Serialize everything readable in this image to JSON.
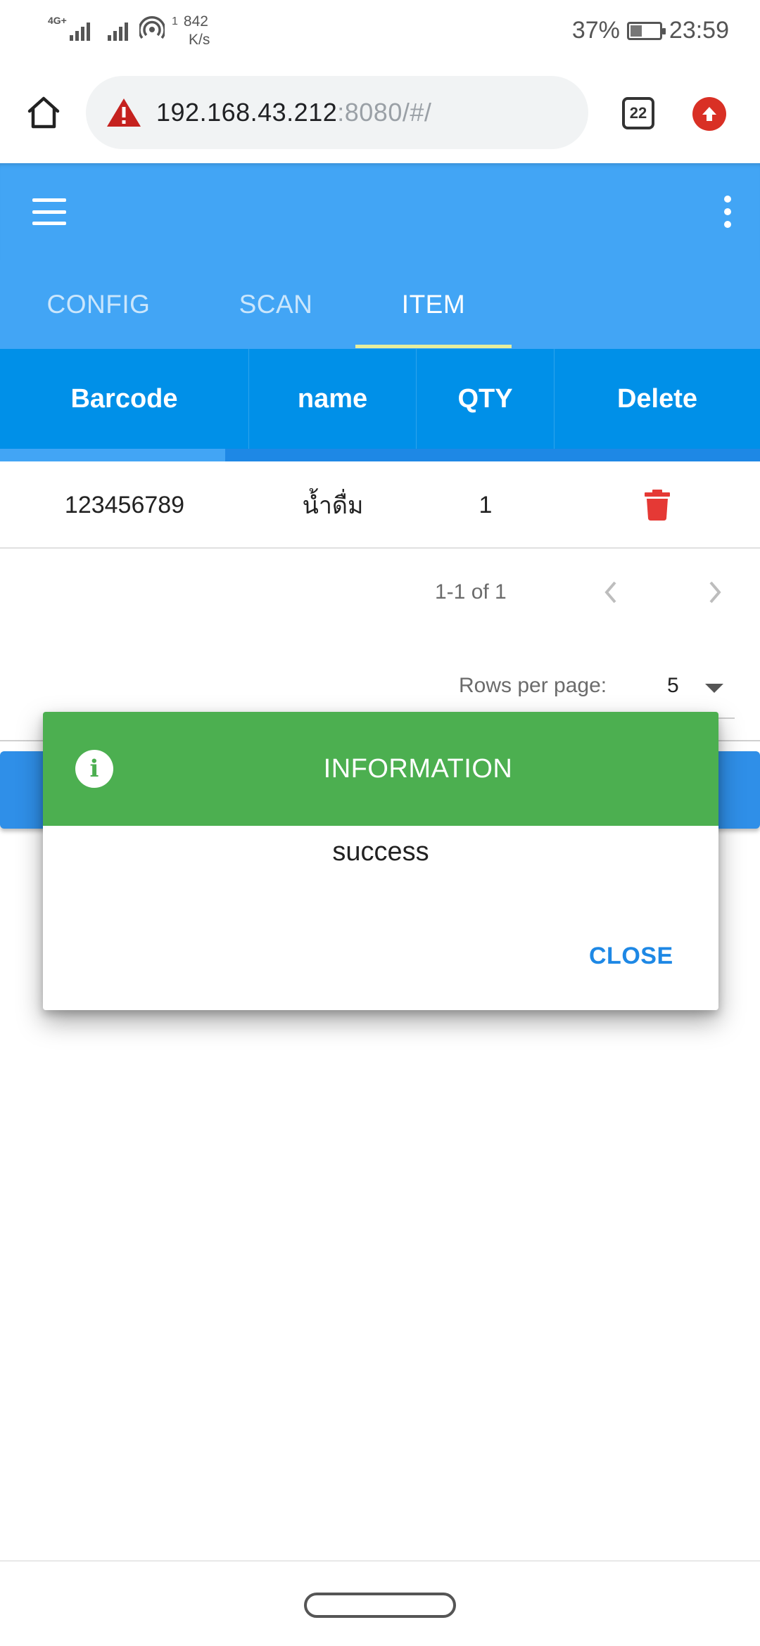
{
  "status_bar": {
    "network_tag": "4G+",
    "speed_prefix": "1",
    "speed_value": "842",
    "speed_unit": "K/s",
    "battery": "37%",
    "time": "23:59"
  },
  "browser": {
    "url_host": "192.168.43.212",
    "url_rest": ":8080/#/",
    "tabs_count": "22"
  },
  "tabs": [
    {
      "label": "CONFIG",
      "active": false
    },
    {
      "label": "SCAN",
      "active": false
    },
    {
      "label": "ITEM",
      "active": true
    }
  ],
  "table": {
    "headers": [
      "Barcode",
      "name",
      "QTY",
      "Delete"
    ],
    "rows": [
      {
        "barcode": "123456789",
        "name": "น้ำดื่ม",
        "qty": "1"
      }
    ]
  },
  "pagination": {
    "range": "1-1 of 1",
    "rows_per_page_label": "Rows per page:",
    "rows_per_page_value": "5"
  },
  "dialog": {
    "title": "INFORMATION",
    "message": "success",
    "close_label": "CLOSE"
  },
  "colors": {
    "primary": "#42a5f5",
    "header": "#0090e8",
    "dialog_header": "#4caf50",
    "delete": "#e53935",
    "accent": "#1e88e5"
  }
}
